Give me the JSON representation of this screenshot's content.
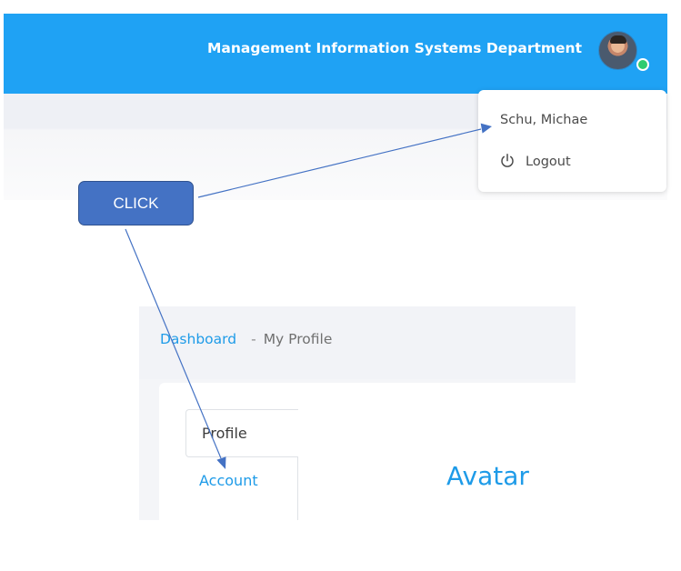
{
  "header": {
    "department_title": "Management Information Systems Department",
    "brand_color": "#1fa2f4",
    "avatar_icon": "user-avatar",
    "status": "online"
  },
  "user_menu": {
    "user_name": "Schu, Michae",
    "logout_label": "Logout",
    "logout_icon": "power-icon"
  },
  "callout": {
    "label": "CLICK",
    "color": "#4472c4"
  },
  "breadcrumb": {
    "link": "Dashboard",
    "separator": "-",
    "current": "My Profile"
  },
  "profile": {
    "tabs": [
      {
        "label": "Profile"
      },
      {
        "label": "Account"
      }
    ],
    "section_heading": "Avatar",
    "accent_color": "#1e9be8"
  }
}
